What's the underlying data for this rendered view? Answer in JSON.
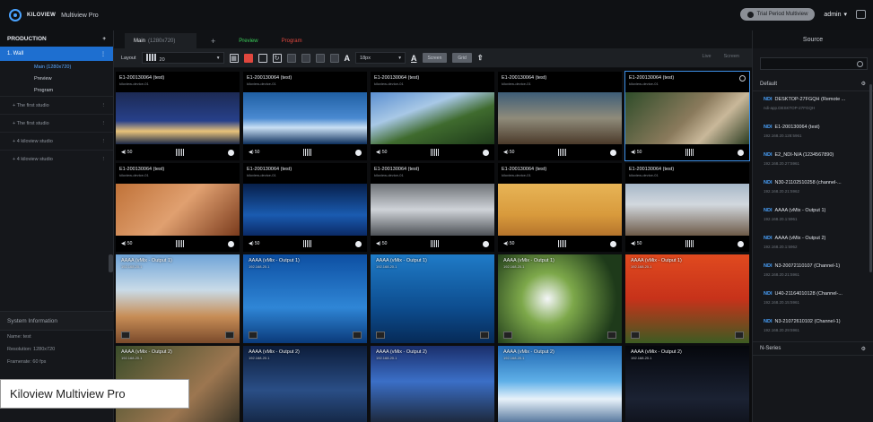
{
  "app": {
    "logo_text": "KILOVIEW",
    "name": "Multiview Pro",
    "trial_label": "Trial Period Multiview",
    "user": "admin"
  },
  "sidebar": {
    "header": "PRODUCTION",
    "wall": "1. Wall",
    "sub_items": [
      "Main (1280x720)",
      "Preview",
      "Program"
    ],
    "studios": [
      "The first studio",
      "The first studio",
      "4 kiloview studio",
      "4 kiloview studio"
    ],
    "system_title": "System Information",
    "system_rows": [
      "Name: test",
      "Resolution: 1280x720",
      "Framerate: 60 fps"
    ]
  },
  "tabs": {
    "main": "Main",
    "main_sub": "(1280x720)",
    "add": "+",
    "preview": "Preview",
    "program": "Program"
  },
  "toolbar": {
    "layout_label": "Layout",
    "layout_value": "20",
    "font_value": "18px",
    "pill1": "Screen",
    "pill2": "Grid",
    "right1": "Live",
    "right2": "Screen"
  },
  "cells": [
    {
      "title": "E1-200130064 (test)",
      "sub": "kiloview-device-01",
      "scene": "s-city",
      "vol": "◀) 50"
    },
    {
      "title": "E1-200130064 (test)",
      "sub": "kiloview-device-01",
      "scene": "s-harbor",
      "vol": "◀) 50"
    },
    {
      "title": "E1-200130064 (test)",
      "sub": "kiloview-device-01",
      "scene": "s-mountain",
      "vol": "◀) 50"
    },
    {
      "title": "E1-200130064 (test)",
      "sub": "kiloview-device-01",
      "scene": "s-beach",
      "vol": "◀) 50"
    },
    {
      "title": "E1-200130064 (test)",
      "sub": "kiloview-device-01",
      "scene": "s-monkey",
      "vol": "◀) 50"
    },
    {
      "title": "E1-200130064 (test)",
      "sub": "kiloview-device-01",
      "scene": "s-bike",
      "vol": "◀) 50"
    },
    {
      "title": "E1-200130064 (test)",
      "sub": "kiloview-device-01",
      "scene": "s-fish",
      "vol": "◀) 50"
    },
    {
      "title": "E1-200130064 (test)",
      "sub": "kiloview-device-01",
      "scene": "s-car",
      "vol": "◀) 50"
    },
    {
      "title": "E1-200130064 (test)",
      "sub": "kiloview-device-01",
      "scene": "s-antelope",
      "vol": "◀) 50"
    },
    {
      "title": "E1-200130064 (test)",
      "sub": "kiloview-device-01",
      "scene": "s-runners",
      "vol": "◀) 50"
    },
    {
      "title": "AAAA (vMix - Output 1)",
      "sub": "192.168.20.1",
      "scene": "s-jeep",
      "vol": ""
    },
    {
      "title": "AAAA (vMix - Output 1)",
      "sub": "192.168.20.1",
      "scene": "s-divers",
      "vol": ""
    },
    {
      "title": "AAAA (vMix - Output 1)",
      "sub": "192.168.20.1",
      "scene": "s-shark",
      "vol": ""
    },
    {
      "title": "AAAA (vMix - Output 1)",
      "sub": "192.168.20.1",
      "scene": "s-flowers",
      "vol": ""
    },
    {
      "title": "AAAA (vMix - Output 1)",
      "sub": "192.168.20.1",
      "scene": "s-tulips",
      "vol": ""
    },
    {
      "title": "AAAA (vMix - Output 2)",
      "sub": "192.168.20.1",
      "scene": "s-monkey2",
      "vol": ""
    },
    {
      "title": "AAAA (vMix - Output 2)",
      "sub": "192.168.20.1",
      "scene": "s-studio",
      "vol": ""
    },
    {
      "title": "AAAA (vMix - Output 2)",
      "sub": "192.168.20.1",
      "scene": "s-press",
      "vol": ""
    },
    {
      "title": "AAAA (vMix - Output 2)",
      "sub": "192.168.20.1",
      "scene": "s-surf",
      "vol": ""
    },
    {
      "title": "AAAA (vMix - Output 2)",
      "sub": "192.168.20.1",
      "scene": "s-space",
      "vol": ""
    }
  ],
  "source": {
    "title": "Source",
    "group1": "Default",
    "group2": "N-Series",
    "items": [
      {
        "name": "DESKTOP-27FGQH (Remote ...",
        "ip": "ndi-app.DESKTOP-27FGQH"
      },
      {
        "name": "E1-200130064 (test)",
        "ip": "192.168.20.128:5961"
      },
      {
        "name": "E2_NDI-N/A (1234567890)",
        "ip": "192.168.20.27:5961"
      },
      {
        "name": "N30-21102510258 (channel-...",
        "ip": "192.168.20.21:5962"
      },
      {
        "name": "AAAA (vMix - Output 1)",
        "ip": "192.168.20.1:5961"
      },
      {
        "name": "AAAA (vMix - Output 2)",
        "ip": "192.168.20.1:5962"
      },
      {
        "name": "N3-20072110107 (Channel-1)",
        "ip": "192.168.20.21:5961"
      },
      {
        "name": "U40-21164010128 (Channel-...",
        "ip": "192.168.20.15:5961"
      },
      {
        "name": "N3-21072610102 (Channel-1)",
        "ip": "192.168.20.29:5961"
      }
    ]
  },
  "caption": "Kiloview Multiview Pro"
}
